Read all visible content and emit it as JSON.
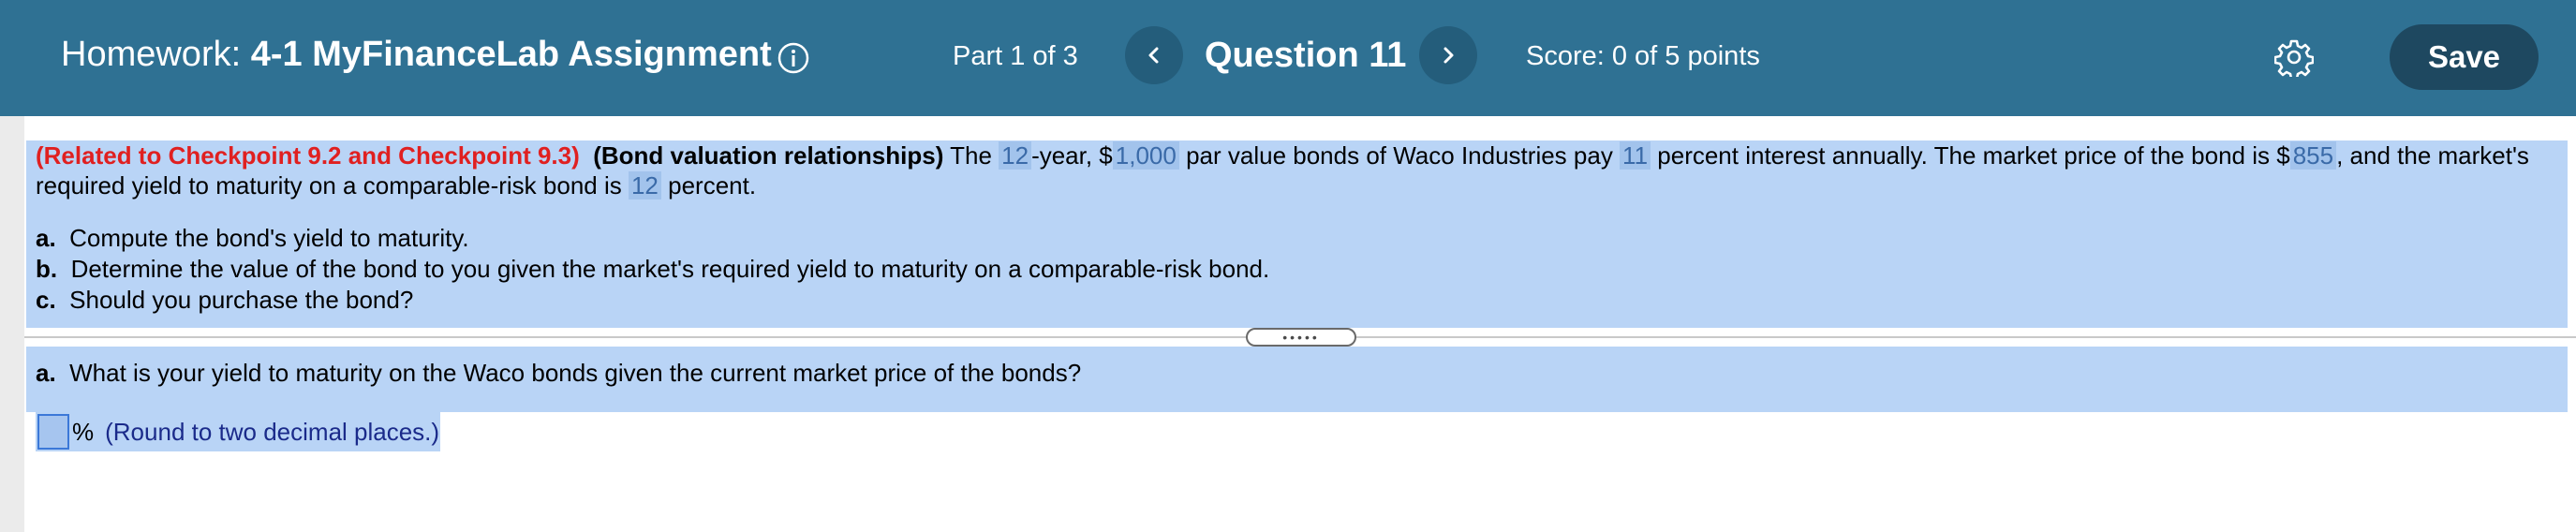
{
  "header": {
    "title_prefix": "Homework: ",
    "title_name": "4-1 MyFinanceLab Assignment",
    "info_icon": "info-icon",
    "part": "Part 1 of 3",
    "prev_icon": "chevron-left-icon",
    "question": "Question 11",
    "next_icon": "chevron-right-icon",
    "score": "Score: 0 of 5 points",
    "settings_icon": "gear-icon",
    "save_label": "Save"
  },
  "colors": {
    "header_bg": "#2f7193",
    "highlight_bg": "#b9d4f6",
    "related_red": "#e02020",
    "save_btn": "#1e4860"
  },
  "problem": {
    "related": "(Related to Checkpoint 9.2 and Checkpoint 9.3)",
    "topic": "(Bond valuation relationships)",
    "t1": " The ",
    "years": "12",
    "t2": "-year, $",
    "par": "1,000",
    "t3": " par value bonds of Waco Industries pay ",
    "rate": "11",
    "t4": " percent interest annually.  The market price of the bond is $",
    "price": "855",
    "t5": ", and the market's",
    "t6": "required yield to maturity on a comparable-risk bond is ",
    "ytm": "12",
    "t7": " percent.",
    "parts": [
      {
        "letter": "a.",
        "text": "Compute the bond's yield to maturity."
      },
      {
        "letter": "b.",
        "text": "Determine the value of the bond to you given the market's required yield to maturity on a comparable-risk bond."
      },
      {
        "letter": "c.",
        "text": "Should you purchase the bond?"
      }
    ]
  },
  "answer": {
    "letter": "a.",
    "question": "What is your yield to maturity on the Waco bonds given the current market price of the bonds?",
    "input_value": "",
    "unit": "%",
    "hint": "(Round to two decimal places.)"
  }
}
